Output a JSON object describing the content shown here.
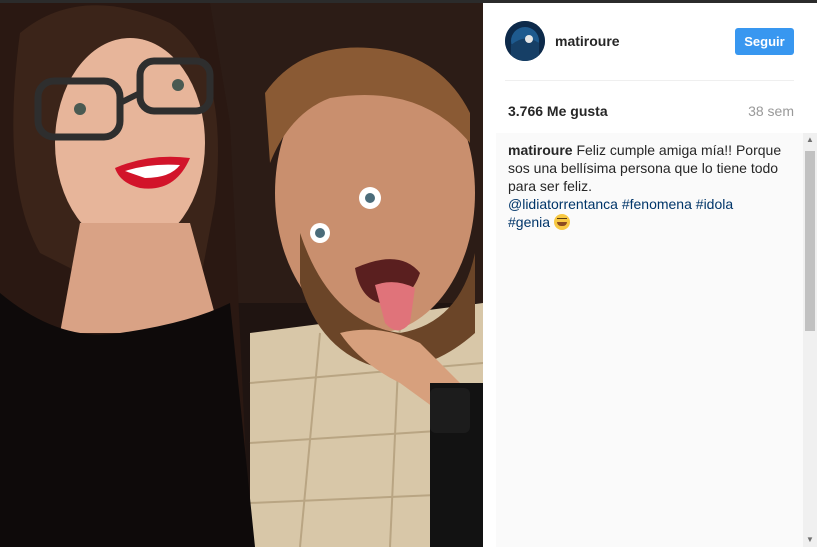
{
  "post": {
    "username": "matiroure",
    "follow_label": "Seguir",
    "likes": "3.766 Me gusta",
    "age": "38 sem"
  },
  "caption": {
    "author": "matiroure",
    "text_1": " Feliz cumple amiga mía!! Porque sos una bellísima persona que lo tiene todo para ser feliz.",
    "mention": "@lidiatorrentanca",
    "tags": [
      "#fenomena",
      "#idola",
      "#genia"
    ],
    "emoji_icon": "grinning-squinting-face-icon"
  },
  "colors": {
    "follow_button": "#3897f0",
    "hashtag": "#003569"
  }
}
